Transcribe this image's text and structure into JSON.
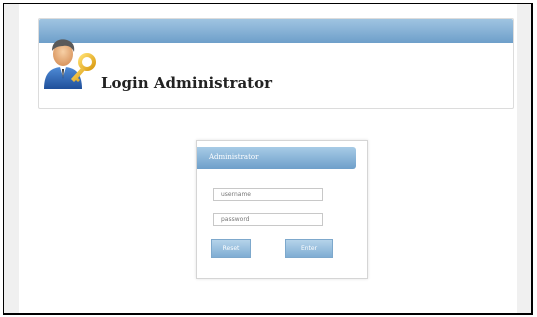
{
  "header": {
    "title": "Login Administrator",
    "icon": "admin-key-icon"
  },
  "login": {
    "title": "Administrator",
    "username_placeholder": "username",
    "password_placeholder": "password",
    "reset_label": "Reset",
    "enter_label": "Enter"
  },
  "colors": {
    "accent": "#7aa9d0",
    "frame_border": "#000000"
  }
}
